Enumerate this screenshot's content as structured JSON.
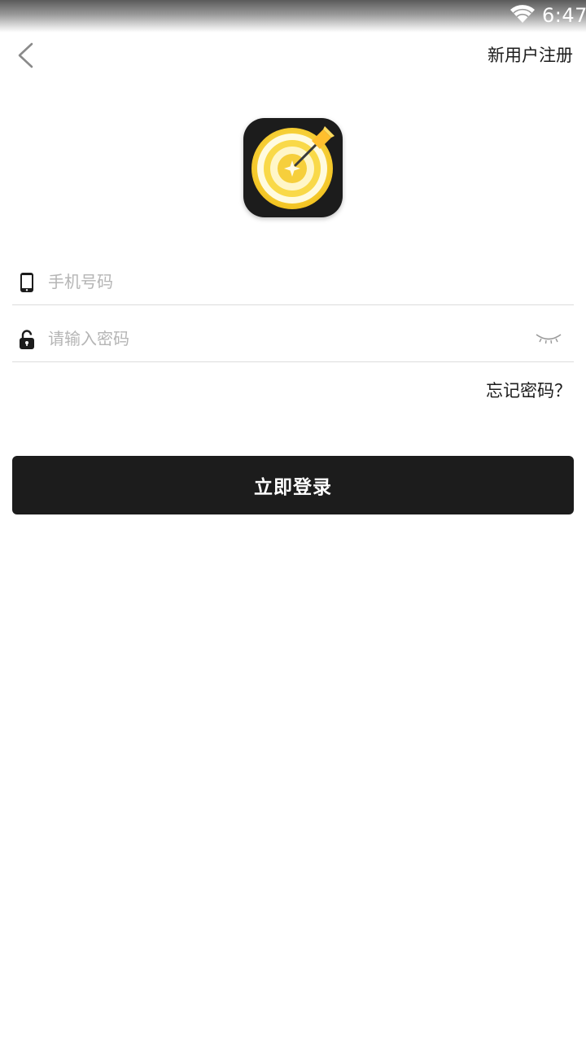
{
  "status_bar": {
    "time": "6:47",
    "wifi_icon": "wifi-icon",
    "text_color": "#ffffff"
  },
  "header": {
    "back_icon": "chevron-left-icon",
    "register_label": "新用户注册"
  },
  "logo": {
    "icon": "dart-target-icon",
    "background_color": "#1c1c1c",
    "accent_color": "#f9d949"
  },
  "form": {
    "phone": {
      "icon": "phone-icon",
      "value": "",
      "placeholder": "手机号码"
    },
    "password": {
      "icon": "unlock-icon",
      "value": "",
      "placeholder": "请输入密码",
      "toggle_icon": "eye-closed-icon"
    },
    "forgot_label": "忘记密码？",
    "submit_label": "立即登录"
  },
  "theme": {
    "primary": "#1c1c1c",
    "placeholder": "#b5b5b5",
    "divider": "#dcdcdc",
    "background": "#ffffff"
  }
}
